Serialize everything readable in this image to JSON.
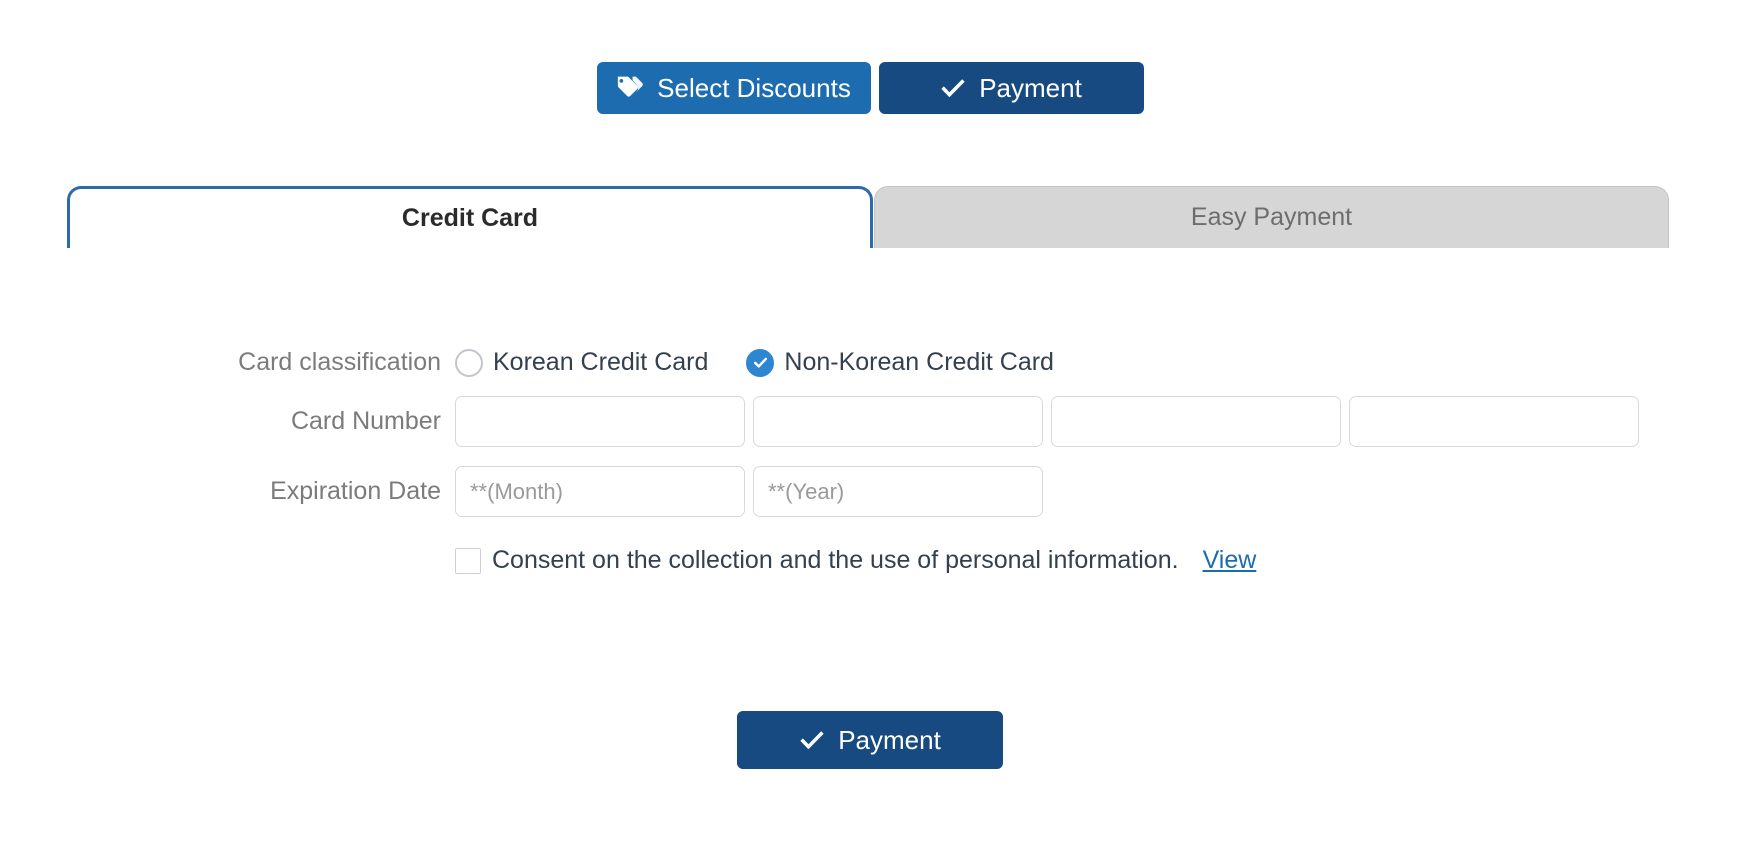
{
  "top_actions": {
    "select_discounts": {
      "label": "Select Discounts",
      "icon": "tags-icon",
      "color": "#1d6cb0"
    },
    "payment": {
      "label": "Payment",
      "icon": "check-icon",
      "color": "#164a81"
    }
  },
  "tabs": [
    {
      "label": "Credit Card",
      "active": true,
      "accent": "#2c6aab"
    },
    {
      "label": "Easy Payment",
      "active": false,
      "accent": "#d6d6d6"
    }
  ],
  "form": {
    "card_classification": {
      "label": "Card classification",
      "options": [
        {
          "label": "Korean Credit Card",
          "selected": false
        },
        {
          "label": "Non-Korean Credit Card",
          "selected": true
        }
      ],
      "selected_color": "#2e86d1"
    },
    "card_number": {
      "label": "Card Number",
      "values": [
        "",
        "",
        "",
        ""
      ],
      "placeholders": [
        "",
        "",
        "",
        ""
      ]
    },
    "expiration_date": {
      "label": "Expiration Date",
      "month": {
        "value": "",
        "placeholder": "**(Month)"
      },
      "year": {
        "value": "",
        "placeholder": "**(Year)"
      }
    },
    "consent": {
      "checked": false,
      "text": "Consent on the collection and the use of personal information.",
      "view_link": "View",
      "link_color": "#1d6cb0"
    }
  },
  "bottom_actions": {
    "payment": {
      "label": "Payment",
      "icon": "check-icon",
      "color": "#164a81"
    }
  }
}
